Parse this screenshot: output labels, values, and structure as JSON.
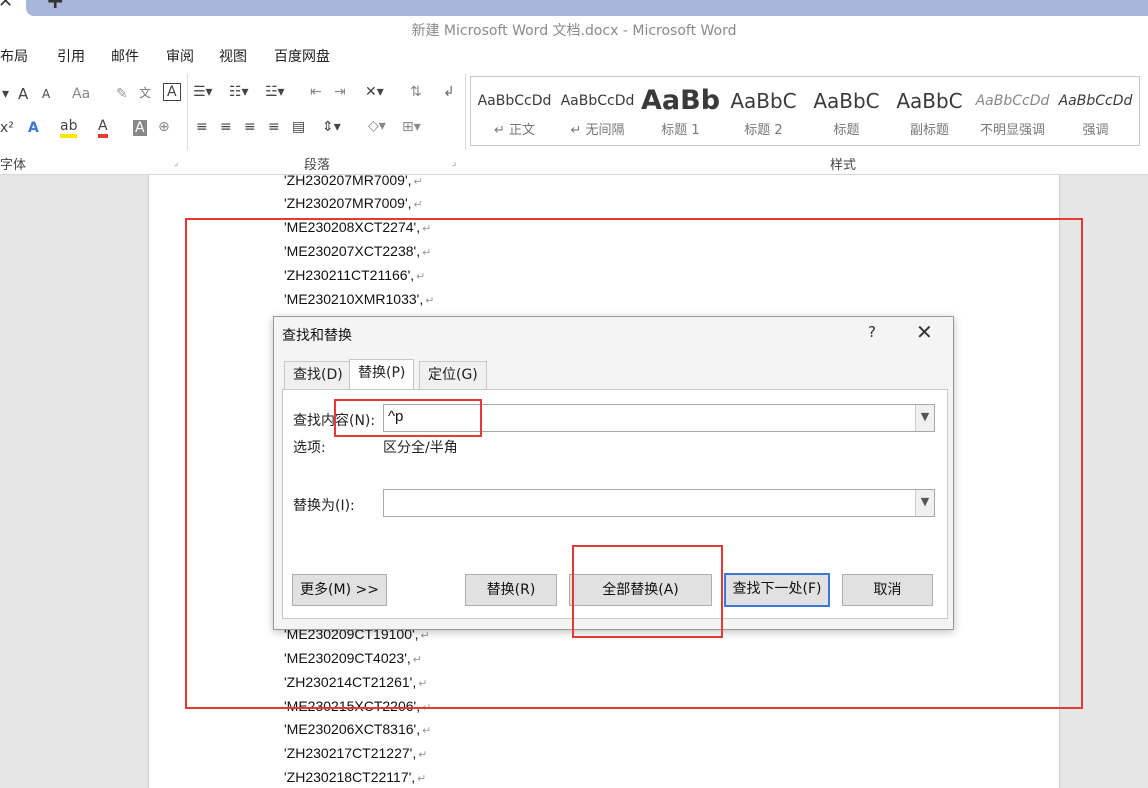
{
  "window": {
    "title": "新建 Microsoft Word 文档.docx - Microsoft Word"
  },
  "tabstrip": {
    "close_glyph": "✕",
    "new_tab_glyph": "+"
  },
  "menu": [
    "布局",
    "引用",
    "邮件",
    "审阅",
    "视图",
    "百度网盘"
  ],
  "ribbon": {
    "groups": {
      "font": "字体",
      "paragraph": "段落",
      "styles": "样式"
    },
    "styles": [
      {
        "sample": "AaBbCcDd",
        "name": "↵ 正文"
      },
      {
        "sample": "AaBbCcDd",
        "name": "↵ 无间隔"
      },
      {
        "sample": "AaBb",
        "name": "标题 1"
      },
      {
        "sample": "AaBbC",
        "name": "标题 2"
      },
      {
        "sample": "AaBbC",
        "name": "标题"
      },
      {
        "sample": "AaBbC",
        "name": "副标题"
      },
      {
        "sample": "AaBbCcDd",
        "name": "不明显强调"
      },
      {
        "sample": "AaBbCcDd",
        "name": "强调"
      }
    ],
    "icons": {
      "font_grow": "A",
      "font_shrink": "A",
      "case": "Aa",
      "clear": "✎",
      "phonetic": "文",
      "border": "A",
      "font_color": "A",
      "highlight": "ab",
      "superscript": "x²"
    }
  },
  "document": {
    "lines_top": [
      "'ZH230207MR7009',",
      "'ZH230207MR7009',",
      "'ME230208XCT2274',",
      "'ME230207XCT2238',",
      "'ZH230211CT21166',",
      "'ME230210XMR1033',"
    ],
    "lines_bottom": [
      "'ME230209CT19100',",
      "'ME230209CT4023',",
      "'ZH230214CT21261',",
      "'ME230215XCT2206',",
      "'ME230206XCT8316',",
      "'ZH230217CT21227',",
      "'ZH230218CT22117',"
    ],
    "para_mark": "↵"
  },
  "dialog": {
    "title": "查找和替换",
    "help": "?",
    "close": "✕",
    "tabs": [
      "查找(D)",
      "替换(P)",
      "定位(G)"
    ],
    "find_label": "查找内容(N):",
    "find_value": "^p",
    "options_label": "选项:",
    "options_value": "区分全/半角",
    "replace_label": "替换为(I):",
    "replace_value": "",
    "buttons": {
      "more": "更多(M) >>",
      "replace": "替换(R)",
      "replace_all": "全部替换(A)",
      "find_next": "查找下一处(F)",
      "cancel": "取消"
    }
  },
  "colors": {
    "annotation": "#e53935",
    "accent": "#3a78d4"
  }
}
